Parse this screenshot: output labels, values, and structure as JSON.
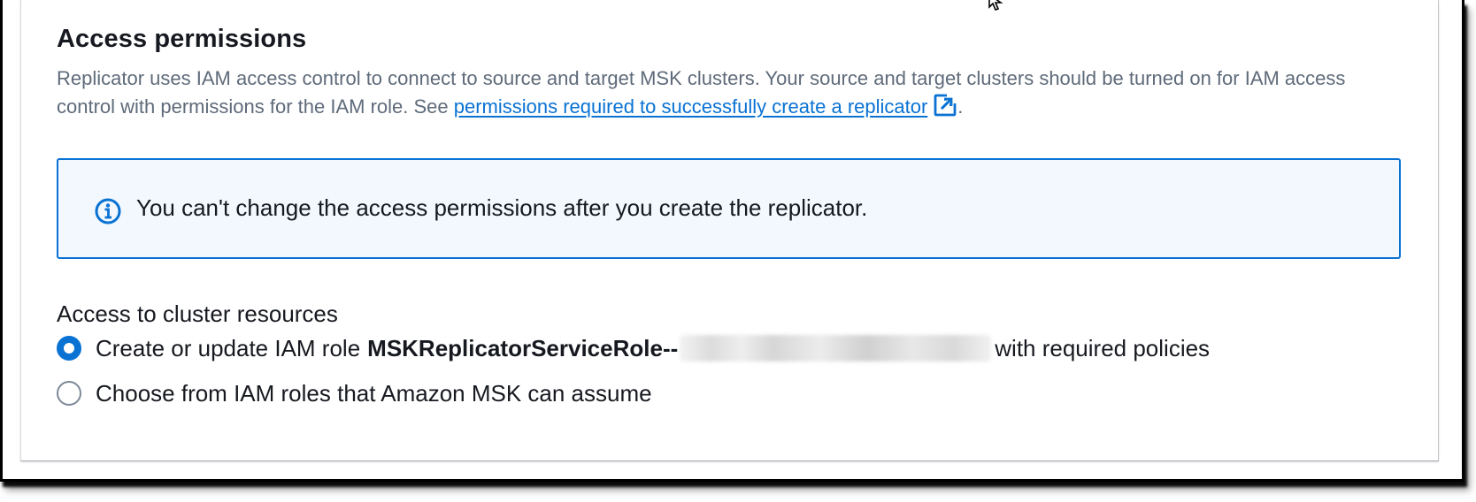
{
  "section": {
    "title": "Access permissions",
    "description_prefix": "Replicator uses IAM access control to connect to source and target MSK clusters. Your source and target clusters should be turned on for IAM access control with permissions for the IAM role. See ",
    "link_text": "permissions required to successfully create a replicator",
    "description_suffix": "."
  },
  "alert": {
    "icon": "info-icon",
    "text": "You can't change the access permissions after you create the replicator."
  },
  "access": {
    "label": "Access to cluster resources",
    "options": [
      {
        "prefix": "Create or update IAM role",
        "role_name": "MSKReplicatorServiceRole--",
        "suffix": "with required policies",
        "selected": true
      },
      {
        "label": "Choose from IAM roles that Amazon MSK can assume",
        "selected": false
      }
    ]
  },
  "colors": {
    "link": "#0972d3",
    "alert_border": "#0972d3",
    "alert_background": "#f2f8fd",
    "text": "#16191f",
    "muted_text": "#5f6b7a"
  }
}
